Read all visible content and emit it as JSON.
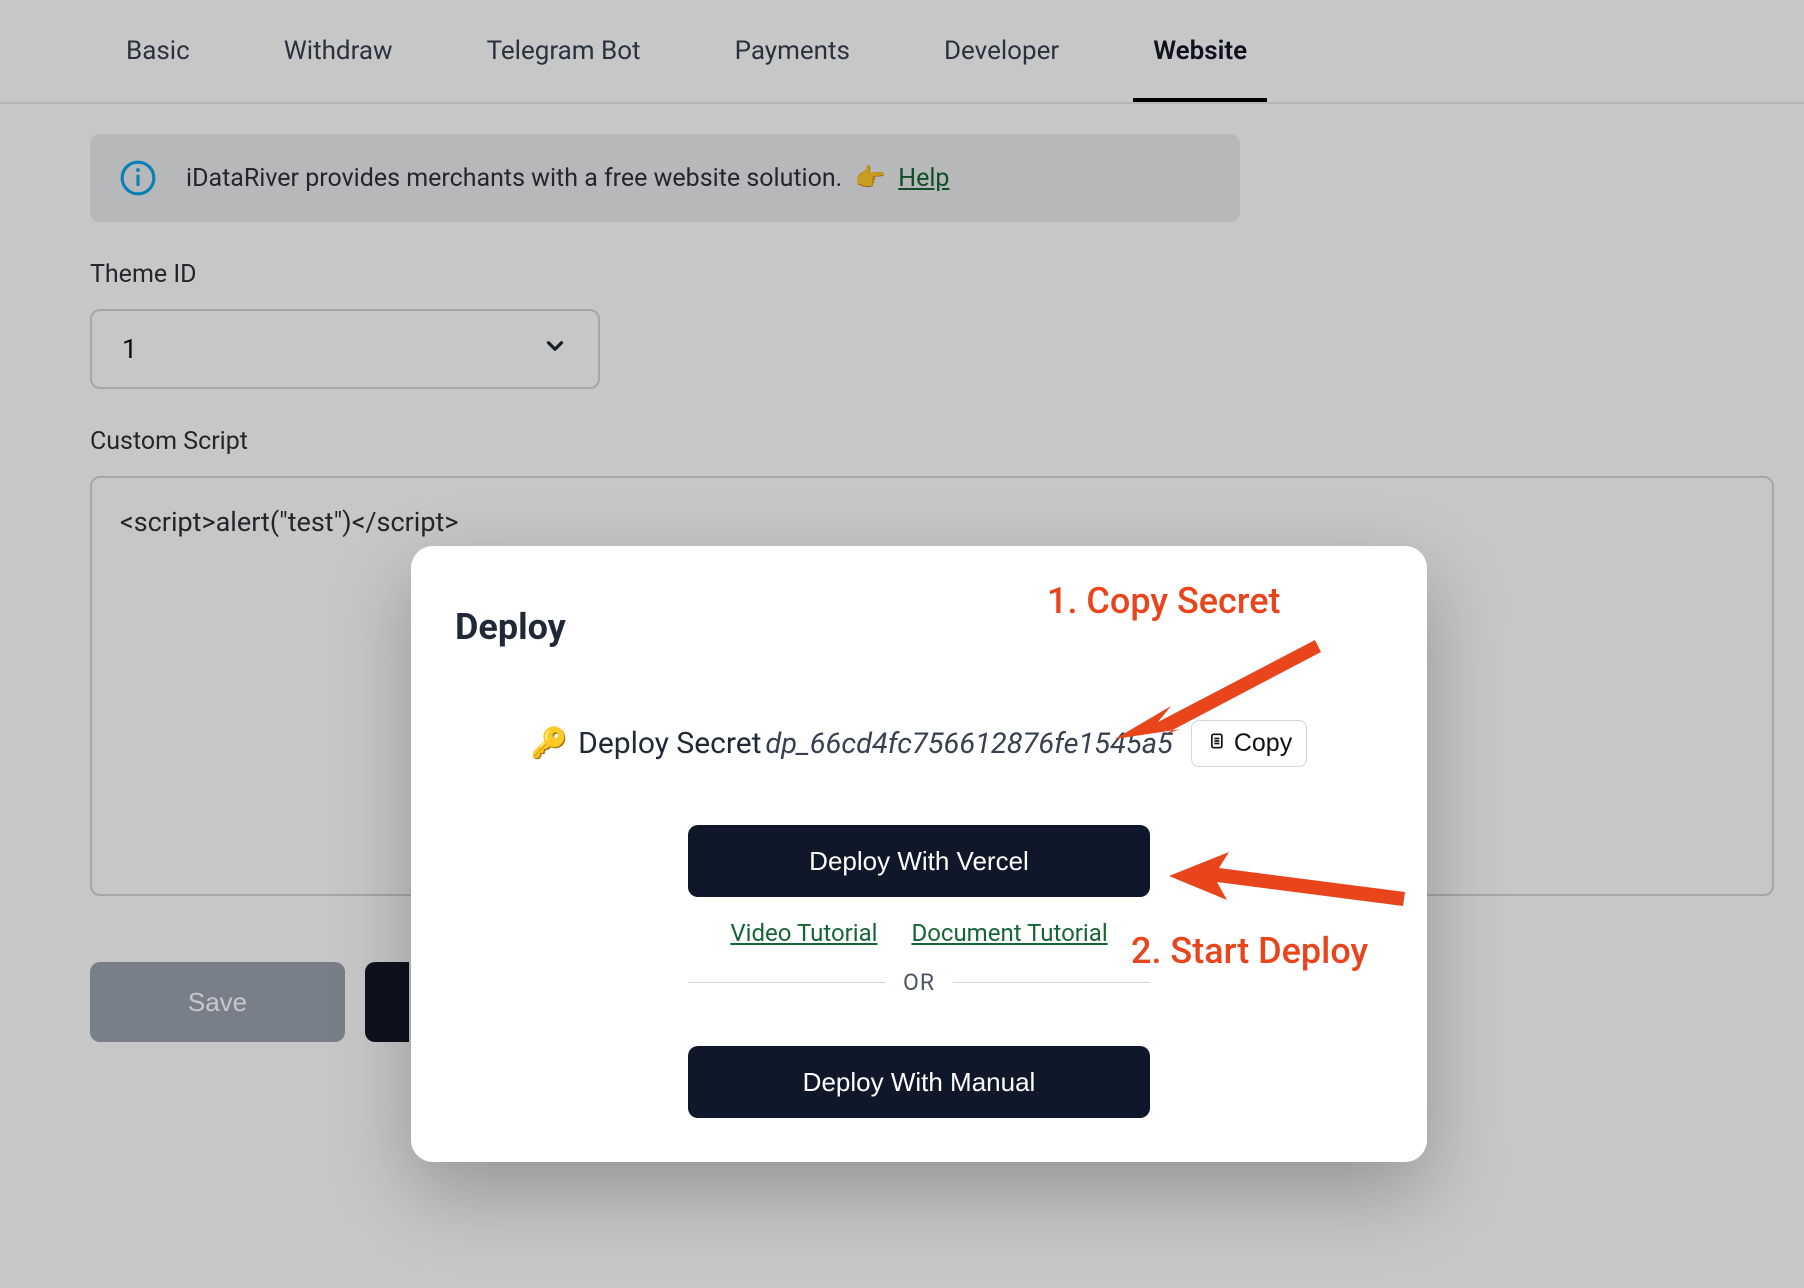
{
  "tabs": {
    "items": [
      {
        "label": "Basic"
      },
      {
        "label": "Withdraw"
      },
      {
        "label": "Telegram Bot"
      },
      {
        "label": "Payments"
      },
      {
        "label": "Developer"
      },
      {
        "label": "Website"
      }
    ],
    "active_index": 5
  },
  "banner": {
    "text": "iDataRiver provides merchants with a free website solution.",
    "emoji": "👉",
    "help_label": "Help"
  },
  "theme_id": {
    "label": "Theme ID",
    "value": "1"
  },
  "custom_script": {
    "label": "Custom Script",
    "value": "<script>alert(\"test\")</script>"
  },
  "buttons": {
    "save": "Save"
  },
  "modal": {
    "title": "Deploy",
    "secret_heading": "Deploy Secret",
    "key_emoji": "🔑",
    "secret_value": "dp_66cd4fc756612876fe1545a5",
    "copy_label": "Copy",
    "deploy_vercel_label": "Deploy With Vercel",
    "video_tutorial_label": "Video Tutorial",
    "document_tutorial_label": "Document Tutorial",
    "or_label": "OR",
    "deploy_manual_label": "Deploy With Manual"
  },
  "annotations": {
    "step1": "1. Copy Secret",
    "step2": "2. Start Deploy"
  }
}
